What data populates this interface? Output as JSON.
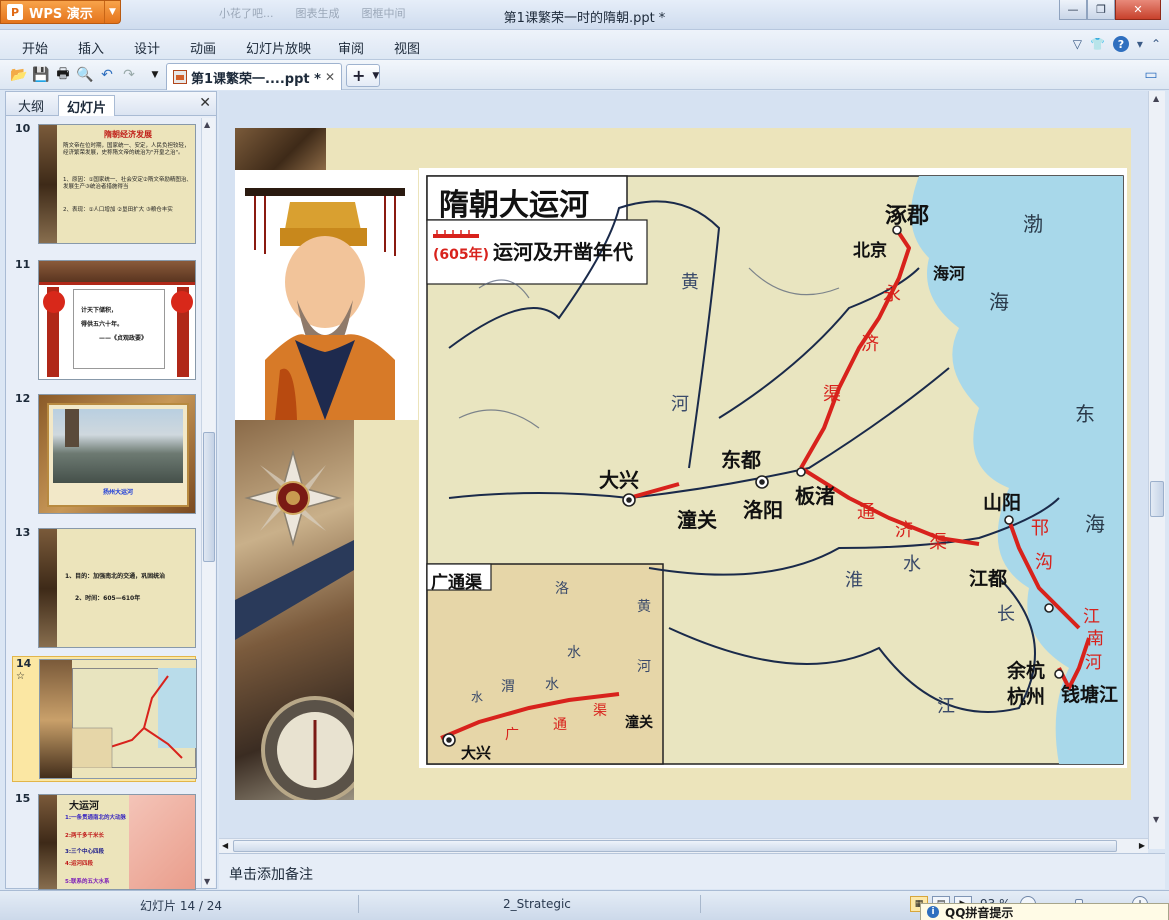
{
  "app": {
    "button_label": "WPS 演示",
    "title": "第1课繁荣一时的隋朝.ppt *",
    "faded_tabs": [
      "小花了吧...",
      "图表生成",
      "图框中间"
    ]
  },
  "menu": [
    "开始",
    "插入",
    "设计",
    "动画",
    "幻灯片放映",
    "审阅",
    "视图"
  ],
  "tabs": {
    "doc_tab": "第1课繁荣一....ppt *",
    "new_tab": "+"
  },
  "left_panel": {
    "tab_outline": "大纲",
    "tab_slides": "幻灯片",
    "thumbnails": [
      {
        "num": "10",
        "title": "隋朝经济发展",
        "lines": [
          "隋文帝在位时期，国家统一、安定，人民负担较轻，经济繁荣发展，史称隋文帝的统治为\"开皇之治\"。",
          "1、原因：①国家统一、社会安定②隋文帝励精图治、发展生产③统治者措施得当",
          "2、表现：①人口增加 ②垦田扩大 ③粮仓丰实"
        ]
      },
      {
        "num": "11",
        "lines": [
          "计天下储积，",
          "得供五六十年。",
          "——《贞观政要》"
        ]
      },
      {
        "num": "12",
        "caption": "扬州大运河"
      },
      {
        "num": "13",
        "lines": [
          "1、目的：加强南北的交通，巩固统治",
          "2、时间：605—610年"
        ]
      },
      {
        "num": "14",
        "mark": "☆"
      },
      {
        "num": "15",
        "title": "大运河",
        "lines": [
          "1:一条贯通南北的大动脉",
          "2:两千多千米长",
          "3:三个中心四段",
          "4:运河四段",
          "5:联系的五大水系"
        ]
      }
    ]
  },
  "map": {
    "title": "隋朝大运河",
    "legend_year": "(605年)",
    "legend_text": "运河及开凿年代",
    "inset_title": "广通渠",
    "cities": [
      "涿郡",
      "北京",
      "大兴",
      "东都",
      "洛阳",
      "板渚",
      "潼关",
      "山阳",
      "江都",
      "余杭",
      "杭州",
      "钱塘江"
    ],
    "rivers": [
      "黄",
      "河",
      "海河",
      "淮",
      "水",
      "长",
      "江"
    ],
    "seas": [
      "渤",
      "海",
      "东",
      "海"
    ],
    "canals": {
      "yongji": [
        "永",
        "济",
        "渠"
      ],
      "tongji": [
        "通",
        "济",
        "渠"
      ],
      "hangou": [
        "邗",
        "沟"
      ],
      "jiangnan": [
        "江",
        "南",
        "河"
      ]
    },
    "inset_labels": {
      "luo": "洛",
      "shui1": "水",
      "huang": "黄",
      "he": "河",
      "wei": "渭",
      "shui2": "水",
      "shui3": "水",
      "guang": "广",
      "tong": "通",
      "qu": "渠",
      "tongguan": "潼关",
      "daxing": "大兴"
    }
  },
  "notes_placeholder": "单击添加备注",
  "status": {
    "slide_counter": "幻灯片 14 / 24",
    "theme": "2_Strategic",
    "zoom": "93 %",
    "popup": "QQ拼音提示"
  },
  "colors": {
    "canal": "#d8221c",
    "sea": "#a8d8ea",
    "land": "#e9e5c0",
    "accent": "#e4741c"
  }
}
